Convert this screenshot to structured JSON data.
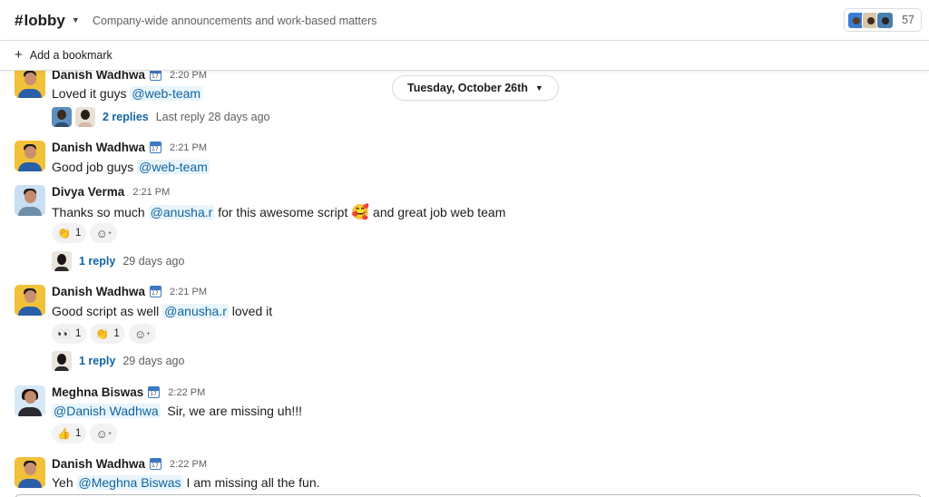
{
  "header": {
    "hash": "#",
    "channel": "lobby",
    "topic": "Company-wide announcements and work-based matters",
    "member_count": "57"
  },
  "bookmark": {
    "label": "Add a bookmark"
  },
  "date_divider": {
    "label": "Tuesday, October 26th"
  },
  "messages": [
    {
      "sender": "Danish Wadhwa",
      "time": "2:20 PM",
      "text_before": "Loved it guys ",
      "mention": "@web-team",
      "text_after": "",
      "thread": {
        "replies": "2 replies",
        "last": "Last reply 28 days ago"
      }
    },
    {
      "sender": "Danish Wadhwa",
      "time": "2:21 PM",
      "text_before": "Good job guys ",
      "mention": "@web-team",
      "text_after": ""
    },
    {
      "sender": "Divya Verma",
      "time": "2:21 PM",
      "text_before": "Thanks so much ",
      "mention": "@anusha.r",
      "text_mid": " for this awesome script ",
      "text_after": " and great job web team",
      "reactions": [
        {
          "emoji": "👏",
          "count": "1"
        }
      ],
      "thread": {
        "replies": "1 reply",
        "last": "29 days ago"
      }
    },
    {
      "sender": "Danish Wadhwa",
      "time": "2:21 PM",
      "text_before": "Good script as well ",
      "mention": "@anusha.r",
      "text_after": " loved it",
      "reactions": [
        {
          "emoji": "👀",
          "count": "1"
        },
        {
          "emoji": "👏",
          "count": "1"
        }
      ],
      "thread": {
        "replies": "1 reply",
        "last": "29 days ago"
      }
    },
    {
      "sender": "Meghna Biswas",
      "time": "2:22 PM",
      "text_before": "",
      "mention": "@Danish Wadhwa",
      "text_after": "  Sir, we are missing uh!!!",
      "reactions": [
        {
          "emoji": "👍",
          "count": "1"
        }
      ]
    },
    {
      "sender": "Danish Wadhwa",
      "time": "2:22 PM",
      "text_before": "Yeh ",
      "mention": "@Meghna Biswas",
      "text_after": " I am missing all the fun."
    }
  ],
  "colors": {
    "link": "#1264a3",
    "mention_bg": "#e8f5fa",
    "danish_avatar_bg": "#f2c13a",
    "divya_avatar_bg": "#c9dff2",
    "meghna_avatar_bg": "#d7e9f7"
  },
  "icons": {
    "channel_chevron": "chevron-down-icon",
    "bookmark_add": "plus-icon",
    "date_chevron": "chevron-down-icon",
    "status": "calendar-icon",
    "add_reaction": "add-reaction-icon"
  }
}
